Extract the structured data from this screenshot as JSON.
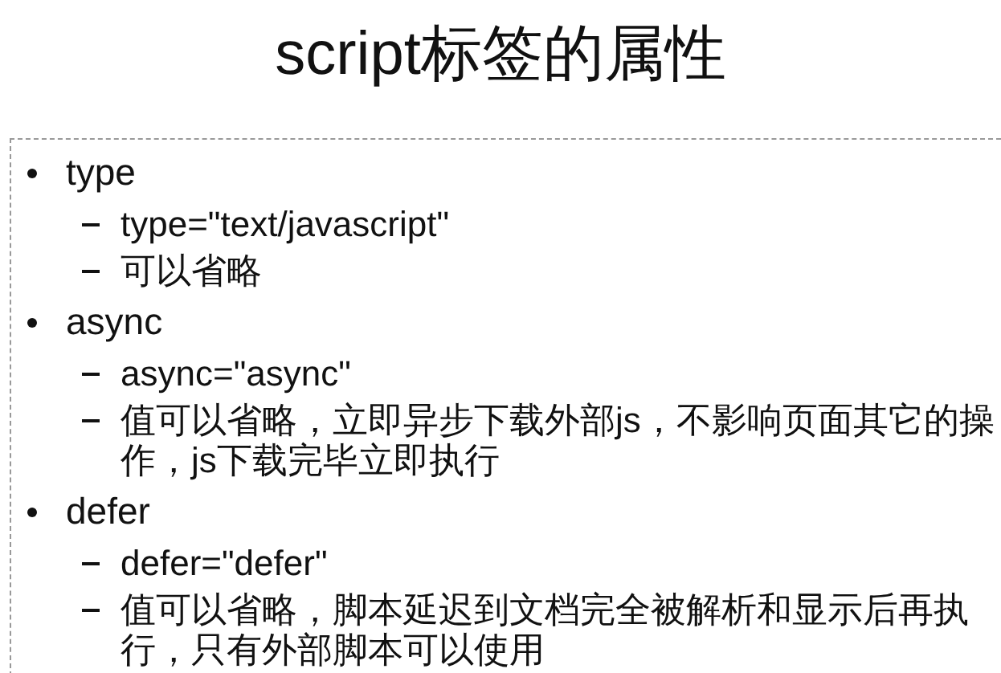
{
  "title": "script标签的属性",
  "items": [
    {
      "text": "type",
      "children": [
        {
          "text": "type=\"text/javascript\""
        },
        {
          "text": "可以省略"
        }
      ]
    },
    {
      "text": "async",
      "children": [
        {
          "text": "async=\"async\""
        },
        {
          "text": "值可以省略，立即异步下载外部js，不影响页面其它的操作，js下载完毕立即执行"
        }
      ]
    },
    {
      "text": "defer",
      "children": [
        {
          "text": "defer=\"defer\""
        },
        {
          "text": "值可以省略，脚本延迟到文档完全被解析和显示后再执行，只有外部脚本可以使用"
        }
      ]
    }
  ]
}
